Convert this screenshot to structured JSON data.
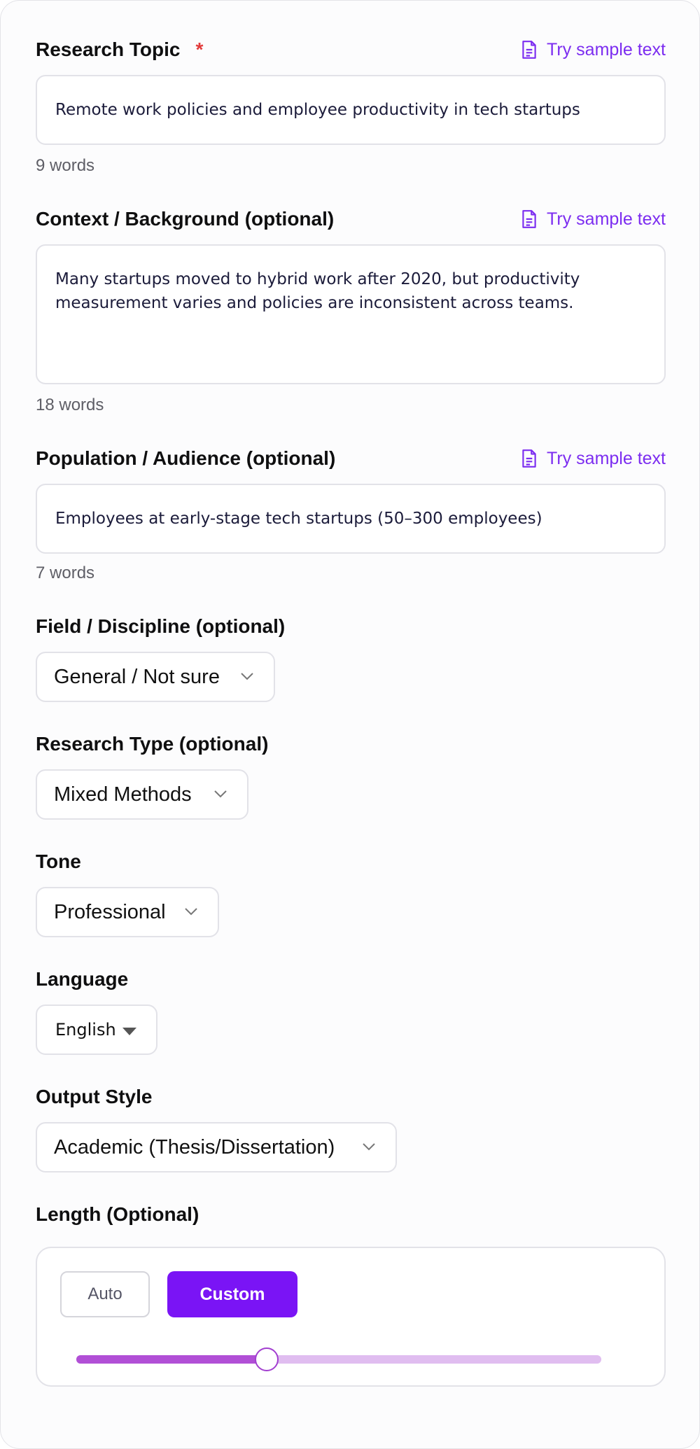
{
  "research_topic": {
    "label": "Research Topic",
    "required_mark": "*",
    "sample_link": "Try sample text",
    "value": "Remote work policies and employee productivity in tech startups",
    "word_count": "9 words"
  },
  "context": {
    "label": "Context / Background (optional)",
    "sample_link": "Try sample text",
    "value": "Many startups moved to hybrid work after 2020, but productivity measurement varies and policies are inconsistent across teams.",
    "word_count": "18 words"
  },
  "population": {
    "label": "Population / Audience (optional)",
    "sample_link": "Try sample text",
    "value": "Employees at early-stage tech startups (50–300 employees)",
    "word_count": "7 words"
  },
  "field": {
    "label": "Field / Discipline (optional)",
    "selected": "General / Not sure"
  },
  "research_type": {
    "label": "Research Type (optional)",
    "selected": "Mixed Methods"
  },
  "tone": {
    "label": "Tone",
    "selected": "Professional"
  },
  "language": {
    "label": "Language",
    "selected": "English"
  },
  "output_style": {
    "label": "Output Style",
    "selected": "Academic (Thesis/Dissertation)"
  },
  "length": {
    "label": "Length (Optional)",
    "auto_label": "Auto",
    "custom_label": "Custom",
    "active_mode": "Custom",
    "slider_fraction": 0.363
  },
  "colors": {
    "accent": "#7a14f5",
    "link": "#7c2df0",
    "required": "#e23b3b",
    "slider_fill": "#b14fd6",
    "slider_track": "#e0bdf0"
  },
  "icons": {
    "sample_link": "document-icon",
    "select": "chevron-down-icon",
    "native_select": "caret-down-icon"
  }
}
